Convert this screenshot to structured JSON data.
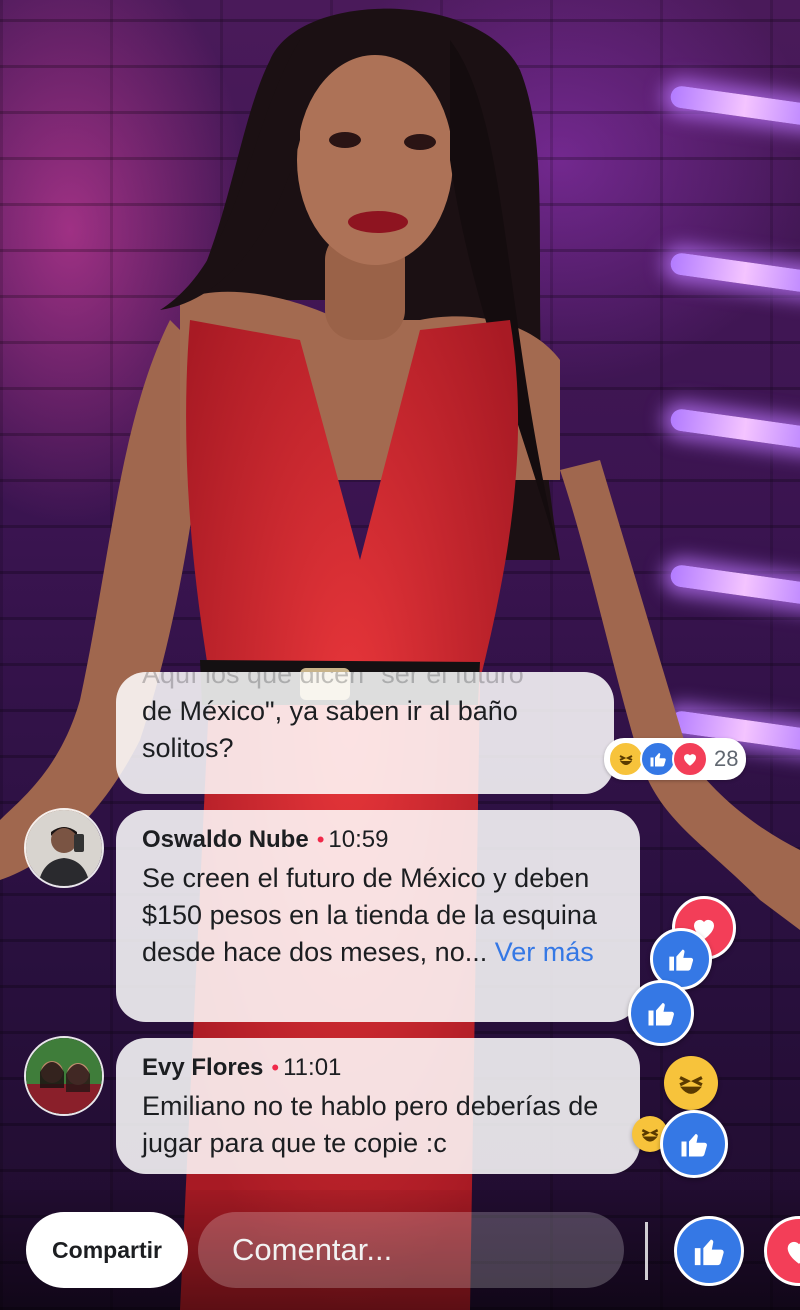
{
  "comments": [
    {
      "partial_top": "Aquí los que dicen \"ser el futuro",
      "line1": "de México\", ya saben ir al baño",
      "line2": "solitos?",
      "reactions_count": "28"
    },
    {
      "name": "Oswaldo Nube",
      "time": "10:59",
      "text": "Se creen el futuro de México y deben $150 pesos en la tienda de la esquina desde hace dos meses, no...",
      "see_more": "Ver más"
    },
    {
      "name": "Evy Flores",
      "time": "11:01",
      "text": "Emiliano no te hablo pero deberías de jugar para que te copie :c"
    }
  ],
  "controls": {
    "share_label": "Compartir",
    "comment_placeholder": "Comentar..."
  },
  "icons": {
    "like": "thumbs-up-icon",
    "love": "heart-icon",
    "haha": "laughing-face-icon"
  },
  "colors": {
    "like_blue": "#3578e5",
    "love_red": "#f33e58",
    "haha_yellow": "#f7c33b",
    "online_dot": "#f02849"
  }
}
